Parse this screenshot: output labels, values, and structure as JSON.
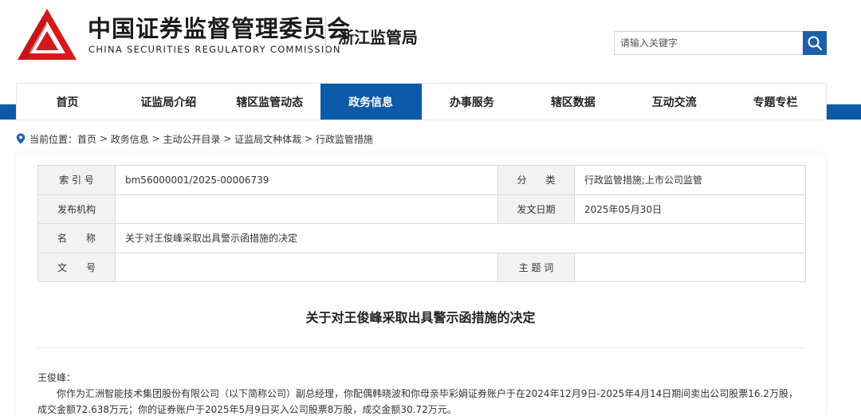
{
  "header": {
    "org_name_cn": "中国证券监督管理委员会",
    "org_name_en": "CHINA SECURITIES REGULATORY COMMISSION",
    "bureau": "浙江监管局",
    "logo_icon": "csrc-logo-icon",
    "brand_color": "#d7191c"
  },
  "search": {
    "placeholder": "请输入关键字",
    "value": "",
    "button_icon": "search-icon"
  },
  "nav": {
    "active_color": "#0d5aa8",
    "items": [
      {
        "label": "首页"
      },
      {
        "label": "证监局介绍"
      },
      {
        "label": "辖区监管动态"
      },
      {
        "label": "政务信息"
      },
      {
        "label": "办事服务"
      },
      {
        "label": "辖区数据"
      },
      {
        "label": "互动交流"
      },
      {
        "label": "专题专栏"
      }
    ],
    "active_index": 3
  },
  "breadcrumb": {
    "icon": "location-pin-icon",
    "prefix": "当前位置：",
    "items": [
      "首页",
      "政务信息",
      "主动公开目录",
      "证监局文种体裁",
      "行政监管措施"
    ],
    "separator": " > "
  },
  "meta": {
    "index_label": "索 引 号",
    "index_value": "bm56000001/2025-00006739",
    "category_label": "分　　类",
    "category_value": "行政监管措施;上市公司监管",
    "publisher_label": "发布机构",
    "publisher_value": "",
    "date_label": "发文日期",
    "date_value": "2025年05月30日",
    "name_label": "名　　称",
    "name_value": "关于对王俊峰采取出具警示函措施的决定",
    "docno_label": "文　　号",
    "docno_value": "",
    "keywords_label": "主 题 词",
    "keywords_value": ""
  },
  "document": {
    "title": "关于对王俊峰采取出具警示函措施的决定",
    "salutation": "王俊峰：",
    "paragraph": "你作为汇洲智能技术集团股份有限公司（以下简称公司）副总经理，你配偶韩晓波和你母亲毕彩娟证券账户于在2024年12月9日-2025年4月14日期间卖出公司股票16.2万股，成交金额72.638万元；你的证券账户于2025年5月9日买入公司股票8万股，成交金额30.72万元。"
  }
}
